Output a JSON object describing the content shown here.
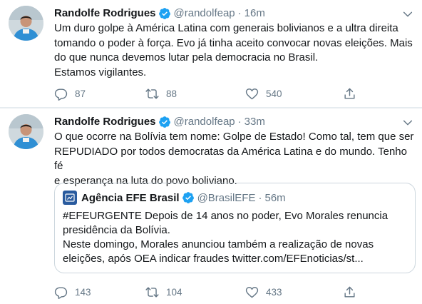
{
  "tweets": [
    {
      "author_name": "Randolfe Rodrigues",
      "handle": "@randolfeap",
      "separator": "·",
      "time": "16m",
      "text_lines": [
        "Um duro golpe à América Latina com generais bolivianos e a ultra direita",
        "tomando o poder à força. Evo já tinha aceito convocar novas eleições. Mais",
        "do que nunca devemos lutar pela democracia no Brasil.",
        "Estamos vigilantes."
      ],
      "replies": "87",
      "retweets": "88",
      "likes": "540"
    },
    {
      "author_name": "Randolfe Rodrigues",
      "handle": "@randolfeap",
      "separator": "·",
      "time": "33m",
      "text_lines": [
        "O que ocorre na Bolívia tem nome: Golpe de Estado! Como tal, tem que ser",
        "REPUDIADO por todos democratas da América Latina e do mundo. Tenho fé",
        "e esperança na luta do povo boliviano."
      ],
      "quoted": {
        "author_name": "Agência EFE Brasil",
        "handle": "@BrasilEFE",
        "separator": "·",
        "time": "56m",
        "text_lines": [
          "#EFEURGENTE Depois de 14 anos no poder, Evo Morales renuncia",
          "presidência da Bolívia.",
          "Neste domingo, Morales anunciou também a realização de novas",
          "eleições, após OEA indicar fraudes twitter.com/EFEnoticias/st..."
        ]
      },
      "replies": "143",
      "retweets": "104",
      "likes": "433"
    }
  ],
  "colors": {
    "verified_blue": "#1da1f2",
    "muted_gray": "#657786",
    "border": "#e6ecf0",
    "efe_blue": "#2a5b9e"
  },
  "icons": [
    "verified-icon",
    "chevron-down-icon",
    "reply-icon",
    "retweet-icon",
    "like-icon",
    "share-icon"
  ]
}
